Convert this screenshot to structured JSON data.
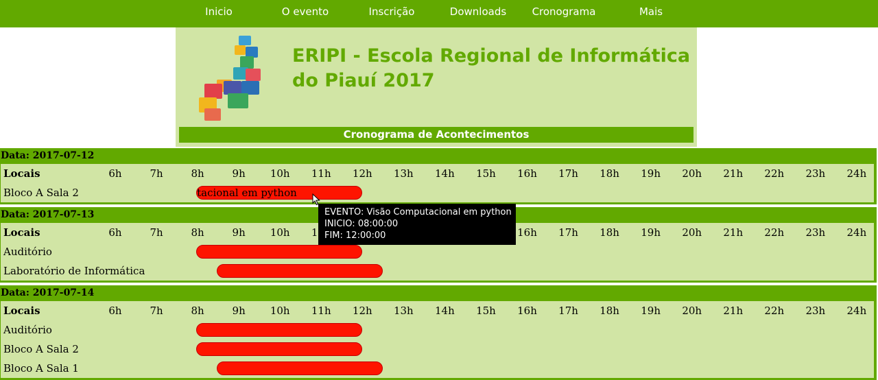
{
  "nav": {
    "items": [
      "Inicio",
      "O evento",
      "Inscrição",
      "Downloads",
      "Cronograma",
      "Mais"
    ]
  },
  "header": {
    "title": "ERIPI - Escola Regional de Informática do Piauí 2017",
    "subtitle": "Cronograma de Acontecimentos"
  },
  "schedule": {
    "locals_label": "Locais",
    "hours": [
      "6h",
      "7h",
      "8h",
      "9h",
      "10h",
      "11h",
      "12h",
      "13h",
      "14h",
      "15h",
      "16h",
      "17h",
      "18h",
      "19h",
      "20h",
      "21h",
      "22h",
      "23h",
      "24h"
    ],
    "days": [
      {
        "title": "Data: 2017-07-12",
        "rows": [
          {
            "local": "Bloco A Sala 2",
            "event": {
              "start": 8.0,
              "end": 12.0,
              "label": "Visão Computacional em python",
              "visible_text": "tacional em python"
            }
          }
        ]
      },
      {
        "title": "Data: 2017-07-13",
        "rows": [
          {
            "local": "Auditório",
            "event": {
              "start": 8.0,
              "end": 12.0
            }
          },
          {
            "local": "Laboratório de Informática",
            "event": {
              "start": 8.5,
              "end": 12.5
            }
          }
        ]
      },
      {
        "title": "Data: 2017-07-14",
        "rows": [
          {
            "local": "Auditório",
            "event": {
              "start": 8.0,
              "end": 12.0
            }
          },
          {
            "local": "Bloco A Sala 2",
            "event": {
              "start": 8.0,
              "end": 12.0
            }
          },
          {
            "local": "Bloco A Sala 1",
            "event": {
              "start": 8.5,
              "end": 12.5
            }
          }
        ]
      }
    ]
  },
  "tooltip": {
    "event": "EVENTO: Visão Computacional em python",
    "inicio": "INICIO: 08:00:00",
    "fim": "FIM: 12:00:00"
  },
  "colors": {
    "brand_green": "#62a900",
    "panel_light_green": "#d1e5a5",
    "event_red": "#fe1400"
  }
}
